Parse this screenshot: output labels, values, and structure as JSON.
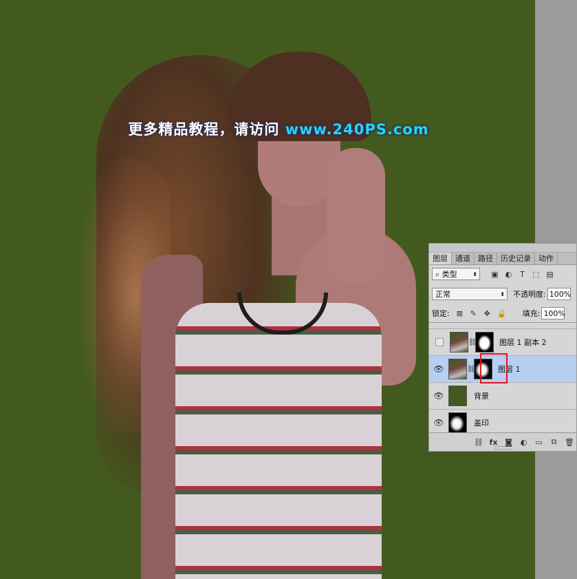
{
  "watermark": {
    "text": "更多精品教程，请访问 ",
    "url": "www.240PS.com"
  },
  "layers_panel": {
    "tabs": [
      "图层",
      "通道",
      "路径",
      "历史记录",
      "动作"
    ],
    "filter": {
      "label": "类型"
    },
    "blend_mode": "正常",
    "opacity": {
      "label": "不透明度:",
      "value": "100%"
    },
    "lock": {
      "label": "锁定:"
    },
    "fill": {
      "label": "填充:",
      "value": "100%"
    },
    "layers": [
      {
        "name": "图层 1 副本 2",
        "visible": false
      },
      {
        "name": "图层 1",
        "visible": true,
        "selected": true
      },
      {
        "name": "背景",
        "visible": true
      },
      {
        "name": "盖印",
        "visible": true
      }
    ],
    "colors": {
      "selected_row": "#b6cff2",
      "highlight_box": "#e0141e"
    }
  },
  "canvas": {
    "background": "#435a1e"
  }
}
